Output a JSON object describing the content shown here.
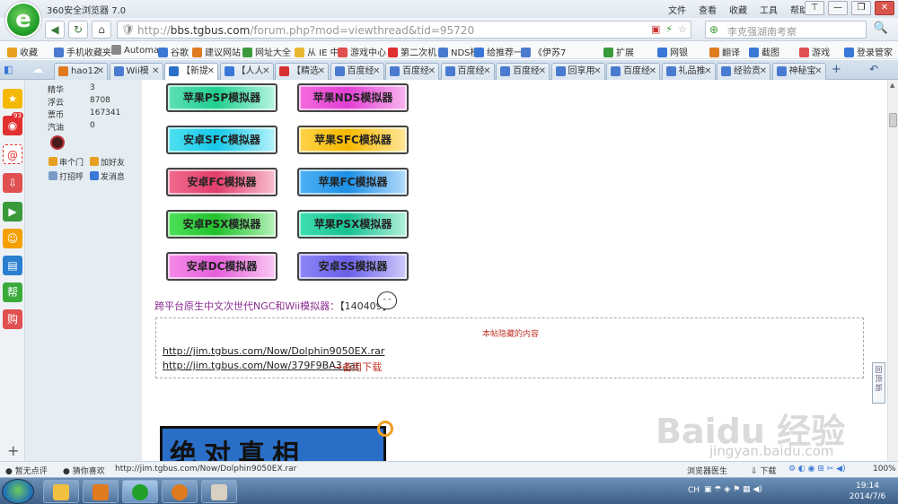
{
  "window": {
    "app_title": "360安全浏览器 7.0",
    "app_logo_glyph": "e",
    "menus": [
      "文件",
      "查看",
      "收藏",
      "工具",
      "帮助"
    ],
    "controls": [
      "⊤",
      "—",
      "❐",
      "✕"
    ]
  },
  "nav": {
    "back": "◀",
    "forward": "▶",
    "refresh": "↻",
    "home": "⌂",
    "url_domain": "bbs.tgbus.com",
    "url_prefix": "http://",
    "url_path": "/forum.php?mod=viewthread&tid=95720",
    "search_placeholder": "李克强湖南考察",
    "search_go": "🔍"
  },
  "bookmarks": [
    {
      "label": "收藏",
      "color": "#e8a020"
    },
    {
      "label": "手机收藏夹",
      "color": "#4a7bd0"
    },
    {
      "label": "Automa",
      "color": "#888888"
    },
    {
      "label": "谷歌",
      "color": "#3a78d8"
    },
    {
      "label": "建议网站",
      "color": "#e07a1f"
    },
    {
      "label": "网址大全",
      "color": "#3a9a3a"
    },
    {
      "label": "从 IE 中",
      "color": "#e8b830"
    },
    {
      "label": "游戏中心",
      "color": "#e05050"
    },
    {
      "label": "第二次机",
      "color": "#e03030"
    },
    {
      "label": "NDS模",
      "color": "#4a7bd0"
    },
    {
      "label": "给推荐一",
      "color": "#3a78d8"
    },
    {
      "label": "《伊苏7",
      "color": "#4a7bd0"
    },
    {
      "label": "扩展",
      "color": "#3a9a3a"
    },
    {
      "label": "网银",
      "color": "#3a78d8"
    },
    {
      "label": "翻译",
      "color": "#e07a1f"
    },
    {
      "label": "截图",
      "color": "#3a78d8"
    },
    {
      "label": "游戏",
      "color": "#e05050"
    },
    {
      "label": "登录管家",
      "color": "#3a78d8"
    }
  ],
  "tabs": [
    {
      "label": "hao12",
      "color": "#e07a1f",
      "active": false
    },
    {
      "label": "Wii模",
      "color": "#4a7bd0",
      "active": false
    },
    {
      "label": "【新提",
      "color": "#2a6fc7",
      "active": true
    },
    {
      "label": "【人人",
      "color": "#3a78d8",
      "active": false
    },
    {
      "label": "【精选",
      "color": "#d83030",
      "active": false
    },
    {
      "label": "百度经",
      "color": "#4a7bd0",
      "active": false
    },
    {
      "label": "百度经",
      "color": "#4a7bd0",
      "active": false
    },
    {
      "label": "百度经",
      "color": "#4a7bd0",
      "active": false
    },
    {
      "label": "百度经",
      "color": "#4a7bd0",
      "active": false
    },
    {
      "label": "回享用",
      "color": "#4a7bd0",
      "active": false
    },
    {
      "label": "百度经",
      "color": "#4a7bd0",
      "active": false
    },
    {
      "label": "礼品推",
      "color": "#4a7bd0",
      "active": false
    },
    {
      "label": "经验贡",
      "color": "#4a7bd0",
      "active": false
    },
    {
      "label": "神秘宝",
      "color": "#4a7bd0",
      "active": false
    }
  ],
  "sidebar_badge": "93",
  "profile": {
    "stats": [
      {
        "label": "精华",
        "value": "3"
      },
      {
        "label": "浮云",
        "value": "8708"
      },
      {
        "label": "票币",
        "value": "167341"
      },
      {
        "label": "汽油",
        "value": "0"
      }
    ],
    "actions": [
      "串个门",
      "加好友",
      "打招呼",
      "发消息"
    ]
  },
  "emulators": [
    {
      "label": "苹果PSP模拟器",
      "bg": "linear-gradient(90deg,#5fe0b6,#1fcf8f 45%,#b8f6e0)"
    },
    {
      "label": "苹果NDS模拟器",
      "bg": "linear-gradient(90deg,#f56bde,#e23fd4 45%,#f8b6ef)"
    },
    {
      "label": "安卓SFC模拟器",
      "bg": "linear-gradient(90deg,#4fe0f0,#16c8e8 45%,#b6f2fa)"
    },
    {
      "label": "苹果SFC模拟器",
      "bg": "linear-gradient(90deg,#ffd34a,#f5b800 45%,#ffe79a)"
    },
    {
      "label": "安卓FC模拟器",
      "bg": "linear-gradient(90deg,#f06a8e,#e23d6a 45%,#f8c0cf)"
    },
    {
      "label": "苹果FC模拟器",
      "bg": "linear-gradient(90deg,#4fb2f5,#1a8fe6 45%,#b6dcfa)"
    },
    {
      "label": "安卓PSX模拟器",
      "bg": "linear-gradient(90deg,#4fe05a,#20c12c 45%,#b6f2b9)"
    },
    {
      "label": "苹果PSX模拟器",
      "bg": "linear-gradient(90deg,#3fdfb0,#16c192 45%,#b2f1dc)"
    },
    {
      "label": "安卓DC模拟器",
      "bg": "linear-gradient(90deg,#f58ae8,#e45fda 45%,#f9c8f2)"
    },
    {
      "label": "安卓SS模拟器",
      "bg": "linear-gradient(90deg,#8c86f5,#6a5fe8 45%,#cfcbfa)"
    }
  ],
  "cross_platform": {
    "title": "跨平台原生中文次世代NGC和Wii模拟器：",
    "count": "【140409】",
    "emoticon": "- -"
  },
  "hidden_content": {
    "title": "本帖隐藏的内容",
    "link1": "http://jim.tgbus.com/Now/Dolphin9050EX.rar",
    "link2": "http://jim.tgbus.com/Now/379F9BA3.rar",
    "backup": "→备用下载"
  },
  "banner_text": "绝对真相",
  "back_to_top": "回顶部",
  "statusbar": {
    "left1": "暂无点评",
    "left2": "猜你喜欢",
    "url": "http://jim.tgbus.com/Now/Dolphin9050EX.rar",
    "speed": "浏览器医生",
    "download": "下载",
    "zoom": "100%"
  },
  "taskbar": {
    "lang": "CH",
    "time": "19:14",
    "date": "2014/7/6"
  },
  "watermark": {
    "brand": "Baidu 经验",
    "url": "jingyan.baidu.com"
  }
}
